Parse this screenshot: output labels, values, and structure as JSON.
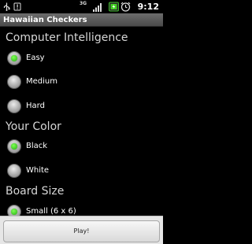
{
  "status_bar": {
    "time": "9:12",
    "network_badge": "3G",
    "icons": [
      "usb-icon",
      "alert-icon",
      "signal-icon",
      "battery-icon",
      "alarm-icon"
    ]
  },
  "title_bar": {
    "title": "Hawaiian Checkers"
  },
  "sections": {
    "intelligence": {
      "title": "Computer Intelligence",
      "options": [
        {
          "label": "Easy",
          "checked": true
        },
        {
          "label": "Medium",
          "checked": false
        },
        {
          "label": "Hard",
          "checked": false
        }
      ]
    },
    "color": {
      "title": "Your Color",
      "options": [
        {
          "label": "Black",
          "checked": true
        },
        {
          "label": "White",
          "checked": false
        }
      ]
    },
    "board": {
      "title": "Board Size",
      "options": [
        {
          "label": "Small (6 x 6)",
          "checked": true
        }
      ]
    }
  },
  "play_button": {
    "label": "Play!"
  },
  "colors": {
    "accent_green": "#3fd01f",
    "background": "#000000"
  }
}
